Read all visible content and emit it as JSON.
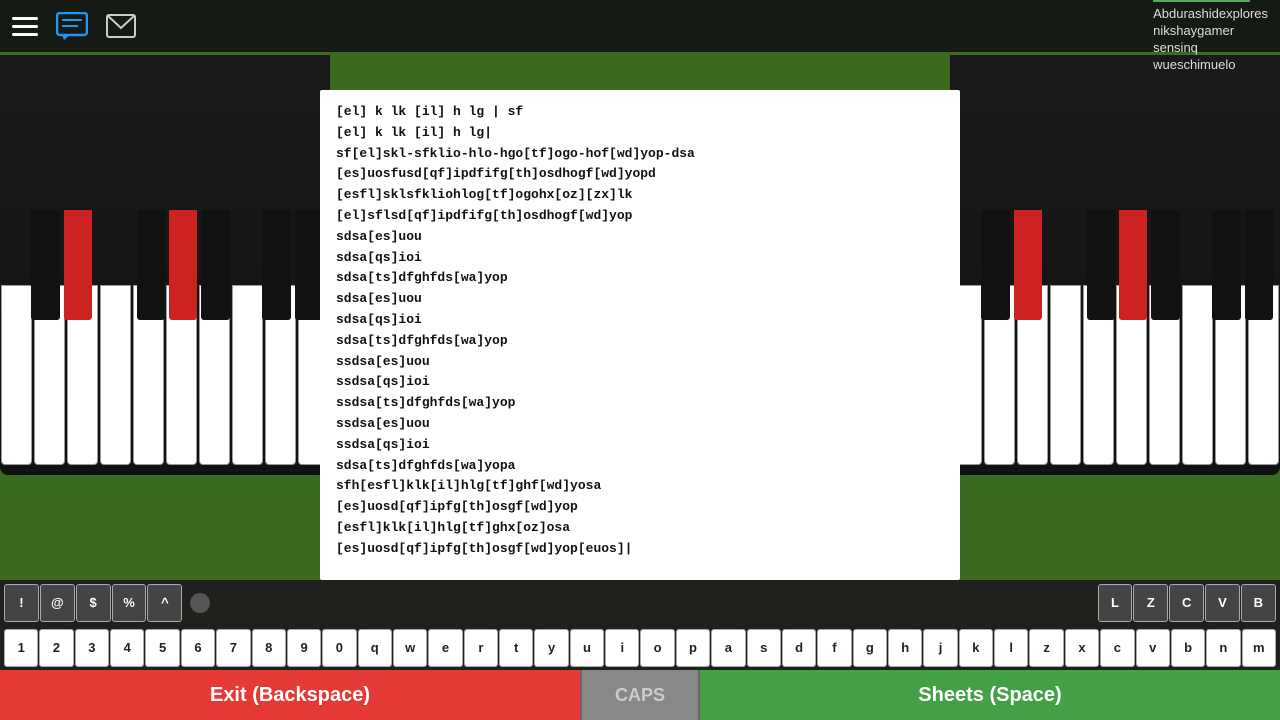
{
  "topbar": {
    "username": "wueschimuelo",
    "players": [
      "Abdurashidexplores",
      "nikshaygamer",
      "sensinq",
      "wueschimuelo"
    ]
  },
  "sheet": {
    "lines": [
      "[el] k lk [il] h lg | sf",
      "[el] k lk [il] h lg|",
      "sf[el]skl-sfklio-hlo-hgo[tf]ogo-hof[wd]yop-dsa",
      "[es]uosfusd[qf]ipdfifg[th]osdhogf[wd]yopd",
      "[esfl]sklsfkliohlog[tf]ogohx[oz][zx]lk",
      "[el]sflsd[qf]ipdfifg[th]osdhogf[wd]yop",
      "sdsa[es]uou",
      "sdsa[qs]ioi",
      "sdsa[ts]dfghfds[wa]yop",
      "sdsa[es]uou",
      "sdsa[qs]ioi",
      "sdsa[ts]dfghfds[wa]yop",
      "ssdsa[es]uou",
      "ssdsa[qs]ioi",
      "ssdsa[ts]dfghfds[wa]yop",
      "ssdsa[es]uou",
      "ssdsa[qs]ioi",
      "sdsa[ts]dfghfds[wa]yopa",
      "sfh[esfl]klk[il]hlg[tf]ghf[wd]yosa",
      "[es]uosd[qf]ipfg[th]osgf[wd]yop",
      "[esfl]klk[il]hlg[tf]ghx[oz]osa",
      "[es]uosd[qf]ipfg[th]osgf[wd]yop[euos]"
    ]
  },
  "bottom_keys_row1_left": [
    "!",
    "@",
    "$",
    "%",
    "^"
  ],
  "bottom_keys_row1_right": [
    "L",
    "Z",
    "C",
    "V",
    "B"
  ],
  "bottom_keys_row2": [
    "1",
    "2",
    "3",
    "4",
    "5",
    "6",
    "7",
    "8",
    "9",
    "0",
    "q",
    "w",
    "e",
    "r",
    "t",
    "y",
    "u",
    "i",
    "o",
    "p",
    "a",
    "s",
    "d",
    "f",
    "g",
    "h",
    "j",
    "k",
    "l",
    "z",
    "x",
    "c",
    "v",
    "b",
    "n",
    "m"
  ],
  "buttons": {
    "exit": "Exit (Backspace)",
    "caps": "CAPS",
    "sheets": "Sheets (Space)"
  }
}
